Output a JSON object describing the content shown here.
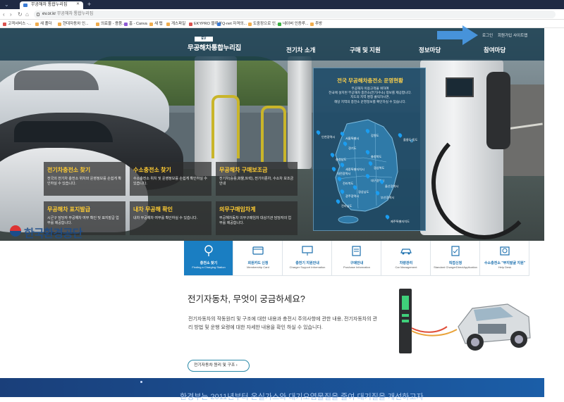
{
  "browser": {
    "tab_title": "무공해차 통합누리집",
    "url_host": "ev.or.kr",
    "url_title": "무공해차 통합누리집",
    "bookmarks": [
      {
        "label": "고객서비스 -...",
        "color": "#d9534f"
      },
      {
        "label": "새 폴더",
        "color": "#f0ad4e"
      },
      {
        "label": "현대자동차 인...",
        "color": "#f0ad4e"
      },
      {
        "label": "의료물 - 용품...",
        "color": "#f0ad4e"
      },
      {
        "label": "홈 - Canva",
        "color": "#8e5bd6"
      },
      {
        "label": "새 탭",
        "color": "#f0ad4e"
      },
      {
        "label": "게스파일",
        "color": "#f0ad4e"
      },
      {
        "label": "EKYPRO 블루션",
        "color": "#d9534f"
      },
      {
        "label": "Q-net 자격의...",
        "color": "#3a7bd5"
      },
      {
        "label": "도중장으로 인...",
        "color": "#f0ad4e"
      },
      {
        "label": "네이버 인증루...",
        "color": "#3cb043"
      },
      {
        "label": "추방",
        "color": "#f0ad4e"
      }
    ]
  },
  "header": {
    "logo_badge": "EV",
    "logo_text": "무공해차통합누리집",
    "util": [
      "로그인",
      "회원가입",
      "사이트맵"
    ],
    "gnb": [
      "전기차 소개",
      "구매 및 지원",
      "정보마당",
      "참여마당"
    ]
  },
  "map_panel": {
    "title": "전국 무공해차충전소 운영현황",
    "desc": [
      "무공해차 이용고객을 위하여",
      "전국에 설치된 무공해차 충전소(전기/수소) 정보를 제공합니다.",
      "지도의 지역 명칭 클릭하시면,",
      "해당 지역의 충전소 운영정보를 확인하실 수 있습니다."
    ],
    "regions": [
      "인천광역시",
      "서울특별시",
      "강원도",
      "경기도",
      "울릉도 독도",
      "충청북도",
      "충청남도",
      "세종특별자치시",
      "대전광역시",
      "경상북도",
      "전라북도",
      "대구광역시",
      "경상남도",
      "울산광역시",
      "광주광역시",
      "부산광역시",
      "전라남도",
      "제주특별자치도"
    ]
  },
  "quick_boxes": [
    {
      "title": "전기차충전소 찾기",
      "desc": "전국의 전기차 충전소 위치와 운영정보를 손쉽게 확인하실 수 있습니다."
    },
    {
      "title": "수소충전소 찾기",
      "desc": "수소충전소 위치 및 운영정보를 손쉽게 확인하실 수 있습니다."
    },
    {
      "title": "무공해차 구매보조금",
      "desc": "전기차(승용,화물,트럭), 전기이륜차, 수소차 보조금 안내"
    },
    {
      "title": "무공해차 표지발급",
      "desc": "시군구 담당자 무공해차 여부 확인 및 표지발급 업무를 제공합니다."
    },
    {
      "title": "내차 무공해 확인",
      "desc": "내차 무공해차 여부를 확인하실 수 있습니다."
    },
    {
      "title": "의무구매임차계",
      "desc": "무공해차동차 의무구매임차 대상기관 담당자의 업무를 제공합니다."
    }
  ],
  "watermark": "한국환경공단",
  "menu": [
    {
      "label": "충전소 찾기",
      "sub": "Finding a Charging Station",
      "icon": "charging-pin-icon"
    },
    {
      "label": "회원카드 신청",
      "sub": "Membership Card",
      "icon": "member-card-icon"
    },
    {
      "label": "충전기 지원안내",
      "sub": "Charger Support Information",
      "icon": "monitor-icon"
    },
    {
      "label": "구매안내",
      "sub": "Purchase Information",
      "icon": "purchase-icon"
    },
    {
      "label": "차량관리",
      "sub": "Car Management",
      "icon": "car-manage-icon"
    },
    {
      "label": "직접신청",
      "sub": "Standard ChargerDirectApplication",
      "icon": "application-icon"
    },
    {
      "label": "수소충전소 \"부지발굴 지원\"",
      "sub": "Help Desk",
      "icon": "hydrogen-icon"
    }
  ],
  "section": {
    "title": "전기자동차, 무엇이 궁금하세요?",
    "desc": "전기자동차의 작동원리 및 구조에 대한 내용과 충전시 주의사항에 관한 내용, 전기자동차의 관리 방법 및 운행 요령에 대한 자세한 내용을 확인 하실 수 있습니다.",
    "button": "전기자동차 원리 및 구조 ›"
  },
  "footer_text": "환경부는 2011년부터 온실가스와 대기오염물질을 줄여 대기질을 개선하고자",
  "colors": {
    "accent": "#1a7ec2",
    "header": "#103448",
    "highlight": "#ffcc33",
    "map_title": "#ffd24a"
  }
}
